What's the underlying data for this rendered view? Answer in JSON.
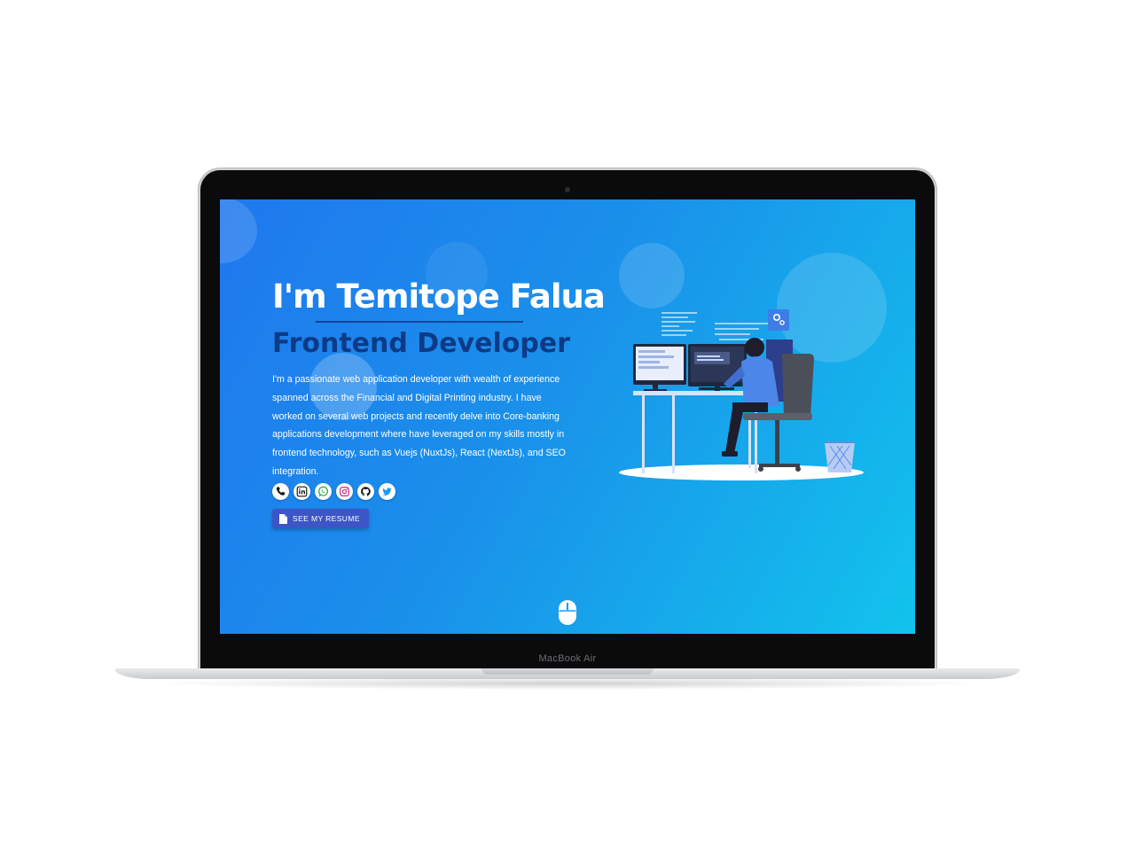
{
  "device": {
    "brand_label": "MacBook Air"
  },
  "hero": {
    "title": "I'm Temitope Falua",
    "subtitle": "Frontend Developer",
    "bio": "I'm a passionate web application developer with wealth of experience spanned across the Financial and Digital Printing industry. I have worked on several web projects and recently delve into Core-banking applications development where have leveraged on my skills mostly in frontend technology, such as Vuejs (NuxtJs), React (NextJs), and SEO integration.",
    "resume_button": {
      "label": "SEE MY RESUME",
      "icon": "document-icon"
    }
  },
  "socials": [
    {
      "name": "phone",
      "icon": "phone-icon"
    },
    {
      "name": "linkedin",
      "icon": "linkedin-icon"
    },
    {
      "name": "whatsapp",
      "icon": "whatsapp-icon"
    },
    {
      "name": "instagram",
      "icon": "instagram-icon"
    },
    {
      "name": "github",
      "icon": "github-icon"
    },
    {
      "name": "twitter",
      "icon": "twitter-icon"
    }
  ],
  "scroll_indicator": {
    "icon": "mouse-icon"
  },
  "colors": {
    "gradient_start": "#1f78ee",
    "gradient_end": "#12c3ec",
    "subtitle": "#0d3a86",
    "button": "#3c56c7"
  }
}
